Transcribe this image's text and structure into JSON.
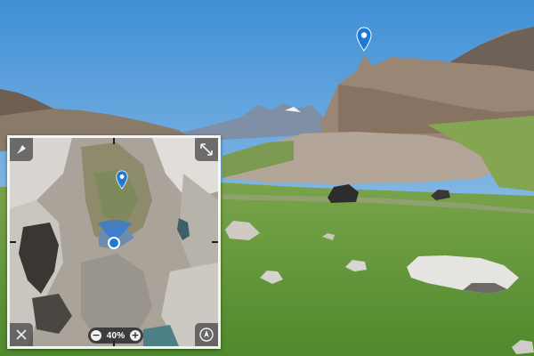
{
  "minimap": {
    "zoom_level": "40%",
    "zoom_out_symbol": "−",
    "zoom_in_symbol": "+",
    "icons": {
      "top_left": "compass-needle-icon",
      "top_right": "fullscreen-icon",
      "bottom_left": "close-icon",
      "bottom_right": "navigation-arrow-icon"
    }
  },
  "scene": {
    "pin_color": "#1e78d6",
    "location_dot_color": "#1e78d6",
    "view_cone_color": "#2a7be0"
  }
}
